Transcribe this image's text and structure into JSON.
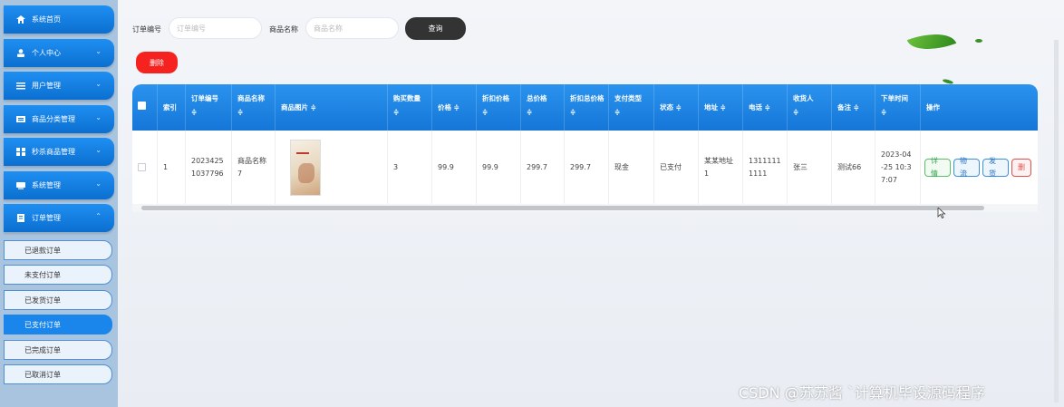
{
  "sidebar": {
    "items": [
      {
        "label": "系统首页",
        "icon": "home-icon"
      },
      {
        "label": "个人中心",
        "icon": "user-icon"
      },
      {
        "label": "用户管理",
        "icon": "list-icon"
      },
      {
        "label": "商品分类管理",
        "icon": "category-icon"
      },
      {
        "label": "秒杀商品管理",
        "icon": "grid-icon"
      },
      {
        "label": "系统管理",
        "icon": "system-icon"
      },
      {
        "label": "订单管理",
        "icon": "order-icon"
      }
    ],
    "sub_items": [
      "已退款订单",
      "未支付订单",
      "已发货订单",
      "已支付订单",
      "已完成订单",
      "已取消订单"
    ],
    "active_sub": "已支付订单"
  },
  "search": {
    "order_no_label": "订单编号",
    "order_no_placeholder": "订单编号",
    "product_name_label": "商品名称",
    "product_name_placeholder": "商品名称",
    "search_button": "查询"
  },
  "toolbar": {
    "delete_button": "删除"
  },
  "table": {
    "columns": [
      "索引",
      "订单编号",
      "商品名称",
      "商品图片",
      "购买数量",
      "价格",
      "折扣价格",
      "总价格",
      "折扣总价格",
      "支付类型",
      "状态",
      "地址",
      "电话",
      "收货人",
      "备注",
      "下单时间",
      "操作"
    ],
    "row": {
      "index": "1",
      "order_no": "2023425 1037796",
      "product_name": "商品名称 7",
      "quantity": "3",
      "price": "99.9",
      "discount_price": "99.9",
      "total": "299.7",
      "discount_total": "299.7",
      "pay_type": "现金",
      "status": "已支付",
      "address": "某某地址 1",
      "phone": "1311111 1111",
      "receiver": "张三",
      "remark": "测试66",
      "time": "2023-04 -25 10:3 7:07"
    },
    "actions": [
      "详情",
      "物流",
      "发货",
      "删"
    ]
  },
  "watermark": "CSDN @苏苏酱 `计算机毕设源码程序"
}
